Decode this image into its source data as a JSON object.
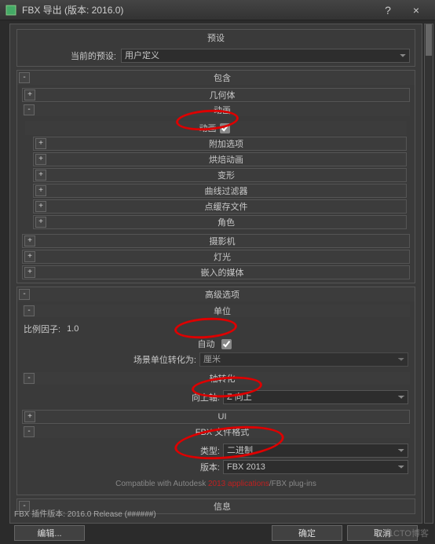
{
  "window": {
    "title": "FBX 导出 (版本: 2016.0)",
    "help": "?",
    "close": "×"
  },
  "preset": {
    "group": "预设",
    "label": "当前的预设:",
    "value": "用户定义"
  },
  "include": {
    "title": "包含",
    "geometry": "几何体",
    "animation": "动画",
    "animation_sub": "动画",
    "extra": "附加选项",
    "bake": "烘焙动画",
    "deform": "变形",
    "filters": "曲线过滤器",
    "cache": "点缓存文件",
    "character": "角色",
    "camera": "摄影机",
    "light": "灯光",
    "media": "嵌入的媒体"
  },
  "advanced": {
    "title": "高级选项",
    "units": "单位",
    "scale_label": "比例因子:",
    "scale_value": "1.0",
    "auto": "自动",
    "scene_convert": "场景单位转化为:",
    "scene_value": "厘米",
    "axis": "轴转化",
    "upaxis_label": "向上轴:",
    "upaxis_value": "Z 向上",
    "ui": "UI",
    "fbxformat": "FBX 文件格式",
    "type_label": "类型:",
    "type_value": "二进制",
    "version_label": "版本:",
    "version_value": "FBX 2013",
    "compat_pre": "Compatible with Autodesk ",
    "compat_mid": "2013 applications",
    "compat_post": "/FBX plug-ins"
  },
  "info": {
    "title": "信息"
  },
  "footer": {
    "edit": "编辑...",
    "ok": "确定",
    "cancel": "取消"
  },
  "plugin_ver": "FBX 插件版本: 2016.0 Release (######)",
  "watermark": "©51CTO博客"
}
